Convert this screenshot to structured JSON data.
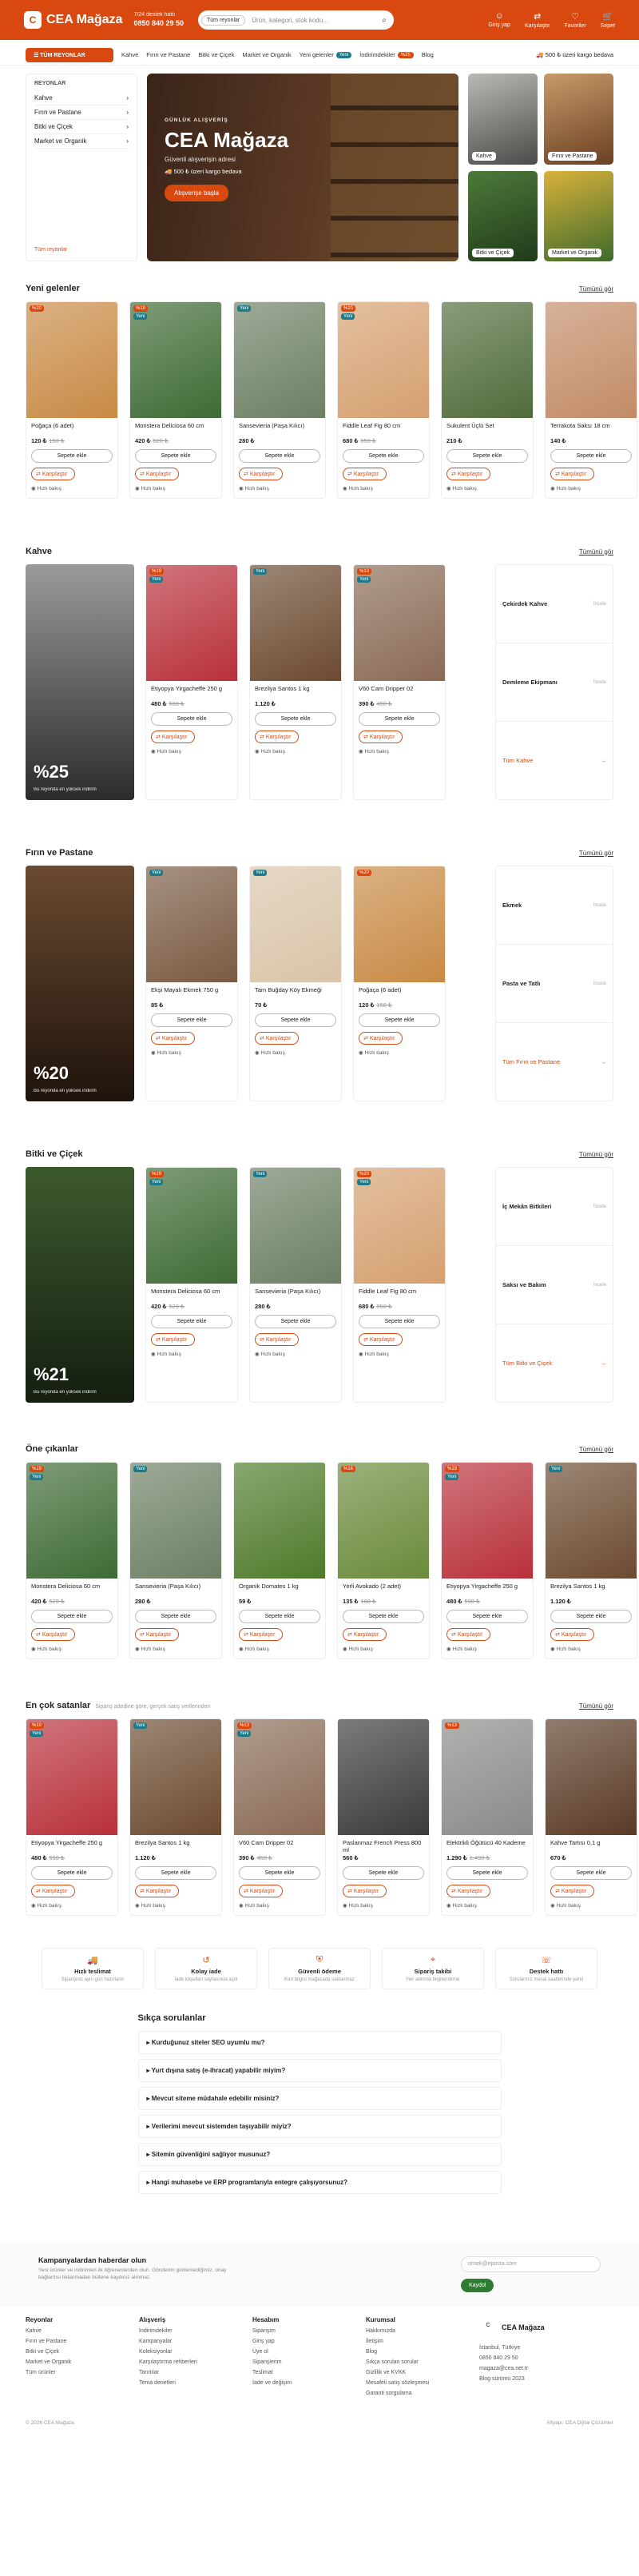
{
  "header": {
    "brand": "CEA Mağaza",
    "logo_letter": "C",
    "phone_label": "7/24 destek hattı",
    "phone": "0850 840 29 50",
    "search_cat": "Tüm reyonlar",
    "search_ph": "Ürün, kategori, stok kodu...",
    "actions": [
      {
        "label": "Giriş yap",
        "icon": "user-icon"
      },
      {
        "label": "Karşılaştır",
        "icon": "compare-icon"
      },
      {
        "label": "Favoriler",
        "icon": "heart-icon"
      },
      {
        "label": "Sepet",
        "icon": "cart-icon"
      }
    ]
  },
  "nav": {
    "all": "TÜM REYONLAR",
    "links": [
      "Kahve",
      "Fırın ve Pastane",
      "Bitki ve Çiçek",
      "Market ve Organik",
      "Yeni gelenler",
      "İndirimdekiler",
      "Blog"
    ],
    "badge_new": "Yeni",
    "badge_sale": "%25",
    "free": "500 ₺ üzeri kargo bedava"
  },
  "sidebar": {
    "title": "REYONLAR",
    "items": [
      "Kahve",
      "Fırın ve Pastane",
      "Bitki ve Çiçek",
      "Market ve Organik"
    ],
    "all": "Tüm reyonlar"
  },
  "hero": {
    "kicker": "GÜNLÜK ALIŞVERİŞ",
    "title": "CEA Mağaza",
    "subtitle": "Güvenli alışverişin adresi",
    "free": "500 ₺ üzeri kargo bedava",
    "cta": "Alışverişe başla"
  },
  "categories": [
    "Kahve",
    "Fırın ve Pastane",
    "Bitki ve Çiçek",
    "Market ve Organik"
  ],
  "ui": {
    "add": "Sepete ekle",
    "compare": "Karşılaştır",
    "quick": "Hızlı bakış",
    "more": "Tümünü gör"
  },
  "new_arrivals": {
    "title": "Yeni gelenler",
    "items": [
      {
        "name": "Poğaça (6 adet)",
        "price": "120 ₺",
        "old": "150 ₺",
        "badges": [
          "%20"
        ]
      },
      {
        "name": "Monstera Deliciosa 60 cm",
        "price": "420 ₺",
        "old": "520 ₺",
        "badges": [
          "%19",
          "Yeni"
        ]
      },
      {
        "name": "Sansevieria (Paşa Kılıcı)",
        "price": "280 ₺",
        "old": "",
        "badges": [
          "Yeni"
        ]
      },
      {
        "name": "Fiddle Leaf Fig 80 cm",
        "price": "680 ₺",
        "old": "850 ₺",
        "badges": [
          "%20",
          "Yeni"
        ]
      },
      {
        "name": "Sukulent Üçlü Set",
        "price": "210 ₺",
        "old": "",
        "badges": []
      },
      {
        "name": "Terrakota Saksı 18 cm",
        "price": "140 ₺",
        "old": "",
        "badges": []
      }
    ]
  },
  "coffee": {
    "title": "Kahve",
    "pct": "%25",
    "pct_sub": "Bu reyonda en yüksek indirim",
    "items": [
      {
        "name": "Etiyopya Yirgacheffe 250 g",
        "price": "480 ₺",
        "old": "590 ₺",
        "badges": [
          "%19",
          "Yeni"
        ]
      },
      {
        "name": "Brezilya Santos 1 kg",
        "price": "1.120 ₺",
        "old": "",
        "badges": [
          "Yeni"
        ]
      },
      {
        "name": "V60 Cam Dripper 02",
        "price": "390 ₺",
        "old": "450 ₺",
        "badges": [
          "%13",
          "Yeni"
        ]
      }
    ],
    "links": [
      "Çekirdek Kahve",
      "Demleme Ekipmanı"
    ],
    "all": "Tüm Kahve"
  },
  "bakery": {
    "title": "Fırın ve Pastane",
    "pct": "%20",
    "pct_sub": "Bu reyonda en yüksek indirim",
    "items": [
      {
        "name": "Ekşi Mayalı Ekmek 750 g",
        "price": "85 ₺",
        "old": "",
        "badges": [
          "Yeni"
        ]
      },
      {
        "name": "Tam Buğday Köy Ekmeği",
        "price": "70 ₺",
        "old": "",
        "badges": [
          "Yeni"
        ]
      },
      {
        "name": "Poğaça (6 adet)",
        "price": "120 ₺",
        "old": "150 ₺",
        "badges": [
          "%20"
        ]
      }
    ],
    "links": [
      "Ekmek",
      "Pasta ve Tatlı"
    ],
    "all": "Tüm Fırın ve Pastane"
  },
  "plants": {
    "title": "Bitki ve Çiçek",
    "pct": "%21",
    "pct_sub": "Bu reyonda en yüksek indirim",
    "items": [
      {
        "name": "Monstera Deliciosa 60 cm",
        "price": "420 ₺",
        "old": "520 ₺",
        "badges": [
          "%19",
          "Yeni"
        ]
      },
      {
        "name": "Sansevieria (Paşa Kılıcı)",
        "price": "280 ₺",
        "old": "",
        "badges": [
          "Yeni"
        ]
      },
      {
        "name": "Fiddle Leaf Fig 80 cm",
        "price": "680 ₺",
        "old": "850 ₺",
        "badges": [
          "%20",
          "Yeni"
        ]
      }
    ],
    "links": [
      "İç Mekân Bitkileri",
      "Saksı ve Bakım"
    ],
    "all": "Tüm Bitki ve Çiçek"
  },
  "featured": {
    "title": "Öne çıkanlar",
    "items": [
      {
        "name": "Monstera Deliciosa 60 cm",
        "price": "420 ₺",
        "old": "520 ₺",
        "badges": [
          "%19",
          "Yeni"
        ]
      },
      {
        "name": "Sansevieria (Paşa Kılıcı)",
        "price": "280 ₺",
        "old": "",
        "badges": [
          "Yeni"
        ]
      },
      {
        "name": "Organik Domates 1 kg",
        "price": "59 ₺",
        "old": "",
        "badges": []
      },
      {
        "name": "Yerli Avokado (2 adet)",
        "price": "135 ₺",
        "old": "160 ₺",
        "badges": [
          "%16"
        ]
      },
      {
        "name": "Etiyopya Yirgacheffe 250 g",
        "price": "480 ₺",
        "old": "590 ₺",
        "badges": [
          "%19",
          "Yeni"
        ]
      },
      {
        "name": "Brezilya Santos 1 kg",
        "price": "1.120 ₺",
        "old": "",
        "badges": [
          "Yeni"
        ]
      }
    ]
  },
  "best": {
    "title": "En çok satanlar",
    "sub": "Sipariş adedine göre, gerçek satış verilerinden",
    "items": [
      {
        "name": "Etiyopya Yirgacheffe 250 g",
        "price": "480 ₺",
        "old": "590 ₺",
        "badges": [
          "%19",
          "Yeni"
        ]
      },
      {
        "name": "Brezilya Santos 1 kg",
        "price": "1.120 ₺",
        "old": "",
        "badges": [
          "Yeni"
        ]
      },
      {
        "name": "V60 Cam Dripper 02",
        "price": "390 ₺",
        "old": "450 ₺",
        "badges": [
          "%13",
          "Yeni"
        ]
      },
      {
        "name": "Paslanmaz French Press 800 ml",
        "price": "560 ₺",
        "old": "",
        "badges": []
      },
      {
        "name": "Elektrikli Öğütücü 40 Kademe",
        "price": "1.290 ₺",
        "old": "1.490 ₺",
        "badges": [
          "%13"
        ]
      },
      {
        "name": "Kahve Tartısı 0,1 g",
        "price": "670 ₺",
        "old": "",
        "badges": []
      }
    ]
  },
  "services": [
    {
      "t": "Hızlı teslimat",
      "d": "Siparişiniz aynı gün hazırlanır"
    },
    {
      "t": "Kolay iade",
      "d": "İade koşulları sayfasında açık"
    },
    {
      "t": "Güvenli ödeme",
      "d": "Kart bilgisi mağazada saklanmaz"
    },
    {
      "t": "Sipariş takibi",
      "d": "Her adımda bilgilendirme"
    },
    {
      "t": "Destek hattı",
      "d": "Sorularınız mesai saatlerinde yanıt"
    }
  ],
  "faq": {
    "title": "Sıkça sorulanlar",
    "q": [
      "Kurduğunuz siteler SEO uyumlu mu?",
      "Yurt dışına satış (e-ihracat) yapabilir miyim?",
      "Mevcut siteme müdahale edebilir misiniz?",
      "Verilerimi mevcut sistemden taşıyabilir miyiz?",
      "Sitemin güvenliğini sağlıyor musunuz?",
      "Hangi muhasebe ve ERP programlarıyla entegre çalışıyorsunuz?"
    ]
  },
  "newsletter": {
    "title": "Kampanyalardan haberdar olun",
    "text": "Yeni ürünler ve indirimleri ilk öğrenenlerden olun. Gönderim günlemediğimiz, onay bağlantısı tıklanmadan bültene kaydınız alınmaz.",
    "ph": "ornek@eposta.com",
    "btn": "Kaydol"
  },
  "footer": {
    "cols": [
      {
        "h": "Reyonlar",
        "l": [
          "Kahve",
          "Fırın ve Pastane",
          "Bitki ve Çiçek",
          "Market ve Organik",
          "Tüm ürünler"
        ]
      },
      {
        "h": "Alışveriş",
        "l": [
          "İndirimdekiler",
          "Kampanyalar",
          "Koleksiyonlar",
          "Karşılaştırma rehberleri",
          "Tanıtılar",
          "Tema denetleri"
        ]
      },
      {
        "h": "Hesabım",
        "l": [
          "Siparişim",
          "Giriş yap",
          "Üye ol",
          "Siparişlerim",
          "Teslimat",
          "İade ve değişim"
        ]
      },
      {
        "h": "Kurumsal",
        "l": [
          "Hakkımızda",
          "İletişim",
          "Blog",
          "Sıkça sorulan sorular",
          "Gizlilik ve KVKK",
          "Mesafeli satış sözleşmesi",
          "Garanti sorgulama"
        ]
      }
    ],
    "brand": "CEA Mağaza",
    "contact": [
      "İstanbul, Türkiye",
      "0850 840 29 50",
      "magaza@cea.net.tr",
      "Blog sürümü 2023"
    ],
    "copy": "© 2026 CEA Mağaza",
    "credit": "Altyapı: CEA Dijital Çözümler"
  }
}
